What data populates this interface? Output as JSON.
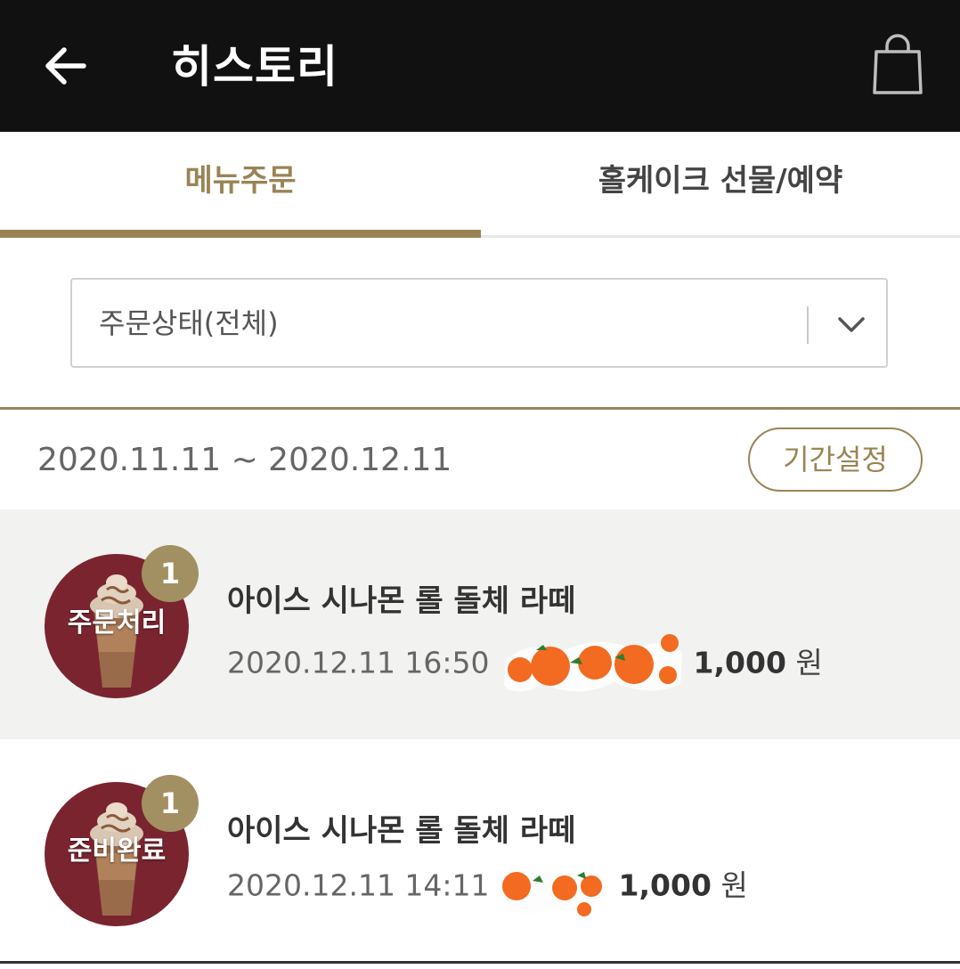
{
  "header": {
    "title": "히스토리",
    "back_icon": "arrow-left-icon",
    "bag_icon": "shopping-bag-icon",
    "background": "#111111"
  },
  "tabs": [
    {
      "label": "메뉴주문",
      "active": true
    },
    {
      "label": "홀케이크 선물/예약",
      "active": false
    }
  ],
  "filter": {
    "selected": "주문상태(전체)",
    "chevron_icon": "chevron-down-icon"
  },
  "period": {
    "range": "2020.11.11 ~ 2020.12.11",
    "button_label": "기간설정"
  },
  "orders": [
    {
      "status": "주문처리",
      "quantity": "1",
      "name": "아이스 시나몬 롤 돌체 라떼",
      "datetime": "2020.12.11 16:50",
      "price": "1,000",
      "currency": "원"
    },
    {
      "status": "준비완료",
      "quantity": "1",
      "name": "아이스 시나몬 롤 돌체 라떼",
      "datetime": "2020.12.11 14:11",
      "price": "1,000",
      "currency": "원"
    }
  ],
  "colors": {
    "accent": "#9a8455",
    "thumb_background": "#7a2430",
    "badge": "#a39062"
  }
}
